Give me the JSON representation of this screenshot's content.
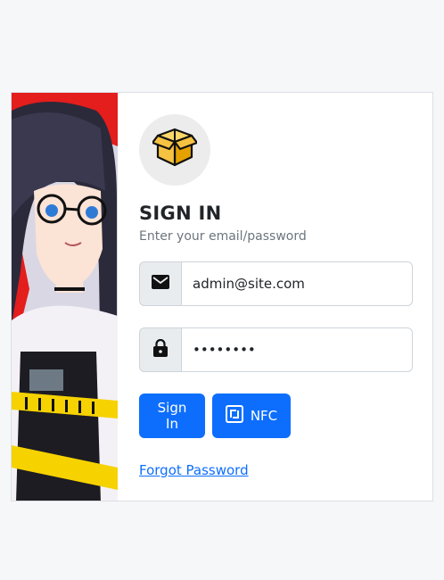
{
  "header": {
    "title": "SIGN IN",
    "subtitle": "Enter your email/password"
  },
  "form": {
    "email_value": "admin@site.com",
    "password_value": "••••••••"
  },
  "buttons": {
    "signin_label": "Sign In",
    "nfc_label": "NFC"
  },
  "links": {
    "forgot_password": "Forgot Password"
  },
  "icons": {
    "logo": "open-box-icon",
    "email": "envelope-icon",
    "password": "lock-icon",
    "nfc": "nfc-icon"
  },
  "colors": {
    "primary": "#0d6efd",
    "box_yellow": "#f5c242",
    "addon_bg": "#e9ecef"
  }
}
